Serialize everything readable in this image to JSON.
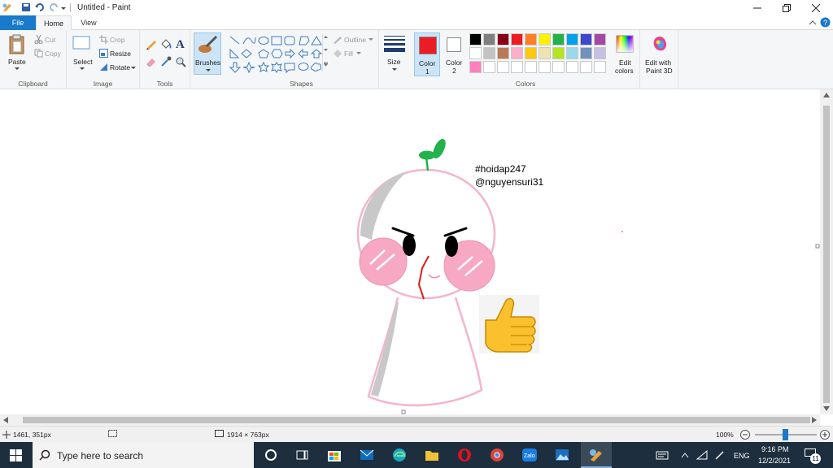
{
  "window": {
    "title": "Untitled - Paint"
  },
  "tabs": [
    {
      "label": "File"
    },
    {
      "label": "Home"
    },
    {
      "label": "View"
    }
  ],
  "ribbon": {
    "clipboard": {
      "label": "Clipboard",
      "paste": "Paste",
      "cut": "Cut",
      "copy": "Copy"
    },
    "image": {
      "label": "Image",
      "select": "Select",
      "crop": "Crop",
      "resize": "Resize",
      "rotate": "Rotate"
    },
    "tools": {
      "label": "Tools"
    },
    "brushes": {
      "label": "Brushes"
    },
    "shapes": {
      "label": "Shapes",
      "outline": "Outline",
      "fill": "Fill"
    },
    "size": {
      "label": "Size"
    },
    "color1": {
      "line1": "Color",
      "line2": "1",
      "value": "#ec1c24"
    },
    "color2": {
      "line1": "Color",
      "line2": "2",
      "value": "#ffffff"
    },
    "colors": {
      "label": "Colors",
      "row1": [
        "#000000",
        "#7f7f7f",
        "#880015",
        "#ed1c24",
        "#ff7f27",
        "#fff200",
        "#22b14c",
        "#00a2e8",
        "#3f48cc",
        "#a349a4"
      ],
      "row2": [
        "#ffffff",
        "#c3c3c3",
        "#b97a57",
        "#ffaec9",
        "#ffc90e",
        "#efe4b0",
        "#b5e61d",
        "#99d9ea",
        "#7092be",
        "#c8bfe7"
      ],
      "row3": [
        "#ff7fbf",
        "#ffffff",
        "#ffffff",
        "#ffffff",
        "#ffffff",
        "#ffffff",
        "#ffffff",
        "#ffffff",
        "#ffffff",
        "#ffffff"
      ]
    },
    "edit_colors": {
      "line1": "Edit",
      "line2": "colors"
    },
    "paint3d": {
      "line1": "Edit with",
      "line2": "Paint 3D"
    }
  },
  "canvas": {
    "text1": "#hoidap247",
    "text2": "@nguyensuri31",
    "colors": {
      "outline": "#f4b5c8",
      "blush": "#f7a9c3",
      "shadow": "#c8c8c8",
      "leaf": "#22b14c",
      "mouth": "#e01d1d"
    }
  },
  "status": {
    "cursor": "1461, 351px",
    "size": "1914 × 763px",
    "zoom": "100%"
  },
  "taskbar": {
    "search_placeholder": "Type here to search",
    "lang": "ENG",
    "time": "9:16 PM",
    "date": "12/2/2021",
    "notifications": "11"
  }
}
